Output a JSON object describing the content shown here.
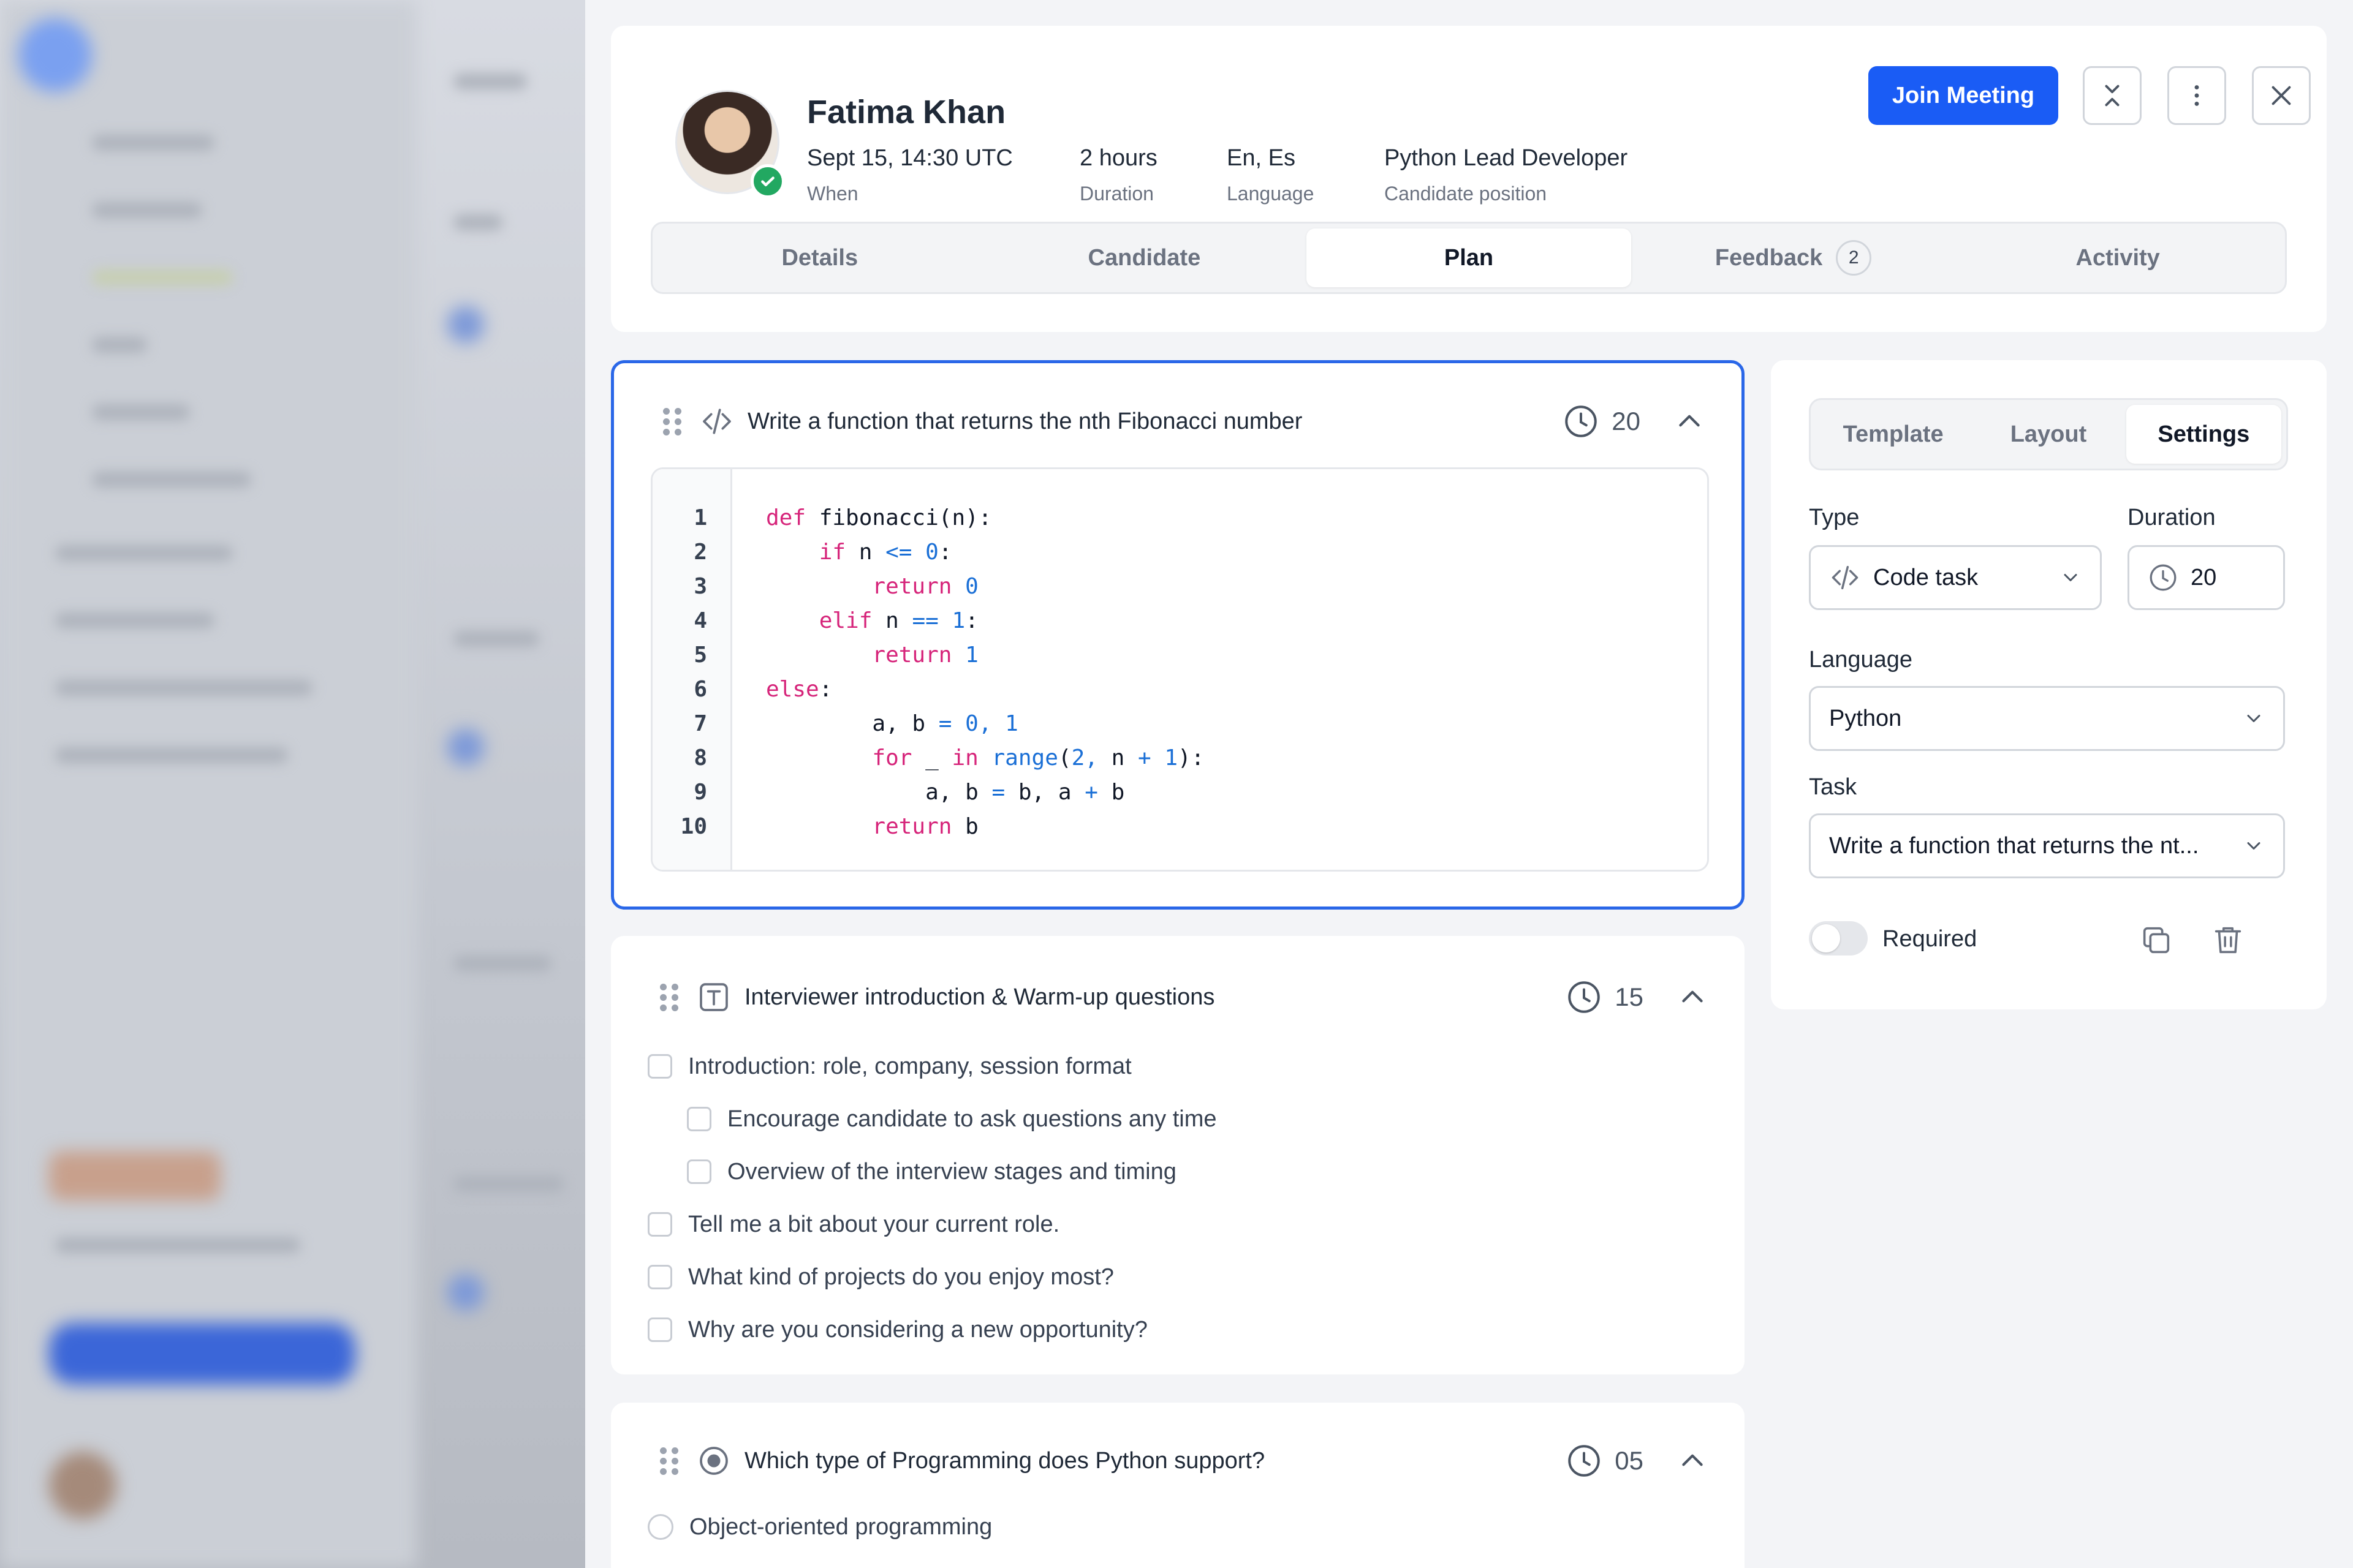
{
  "candidate": {
    "name": "Fatima Khan",
    "when_value": "Sept 15, 14:30 UTC",
    "when_label": "When",
    "duration_value": "2 hours",
    "duration_label": "Duration",
    "language_value": "En, Es",
    "language_label": "Language",
    "position_value": "Python Lead Developer",
    "position_label": "Candidate position"
  },
  "header": {
    "join_label": "Join Meeting",
    "icons": [
      "collapse-icon",
      "more-vertical-icon",
      "close-icon"
    ]
  },
  "tabs": [
    {
      "label": "Details"
    },
    {
      "label": "Candidate"
    },
    {
      "label": "Plan",
      "active": true
    },
    {
      "label": "Feedback",
      "badge": "2"
    },
    {
      "label": "Activity"
    }
  ],
  "tasks": [
    {
      "title": "Write a function that returns the nth Fibonacci number",
      "minutes": "20",
      "type_icon": "code-icon",
      "code_lines": [
        "1",
        "2",
        "3",
        "4",
        "5",
        "6",
        "7",
        "8",
        "9",
        "10"
      ]
    },
    {
      "title": "Interviewer introduction & Warm-up questions",
      "minutes": "15",
      "type_icon": "text-icon",
      "items": [
        "Introduction: role, company, session format",
        "Encourage candidate to ask questions any time",
        "Overview of the interview stages and timing",
        "Tell me a bit about your current role.",
        "What kind of projects do you enjoy most?",
        "Why are you considering a new opportunity?"
      ]
    },
    {
      "title": "Which type of Programming does Python support?",
      "minutes": "05",
      "type_icon": "radio-icon",
      "options": [
        "Object-oriented programming"
      ]
    }
  ],
  "settings": {
    "tabs": [
      {
        "label": "Template"
      },
      {
        "label": "Layout"
      },
      {
        "label": "Settings",
        "active": true
      }
    ],
    "type_label": "Type",
    "type_value": "Code task",
    "duration_label": "Duration",
    "duration_value": "20",
    "language_label": "Language",
    "language_value": "Python",
    "task_label": "Task",
    "task_value": "Write a function that returns the nt...",
    "required_label": "Required"
  },
  "colors": {
    "accent": "#1a5cf5",
    "selected_border": "#2a67e8",
    "online": "#22a861"
  }
}
